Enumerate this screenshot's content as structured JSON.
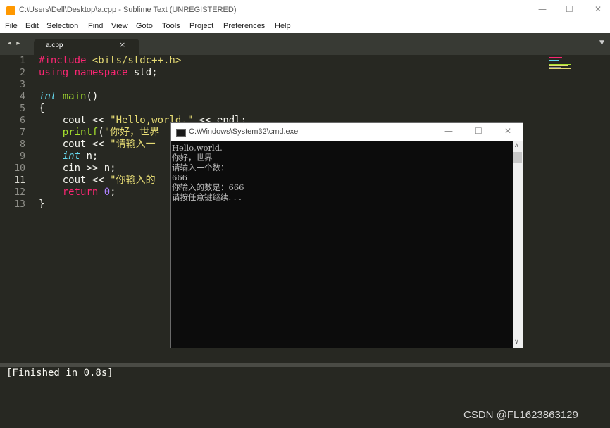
{
  "window": {
    "title": "C:\\Users\\Dell\\Desktop\\a.cpp - Sublime Text (UNREGISTERED)",
    "minimize_glyph": "—",
    "maximize_glyph": "☐",
    "close_glyph": "✕"
  },
  "menu": [
    "File",
    "Edit",
    "Selection",
    "Find",
    "View",
    "Goto",
    "Tools",
    "Project",
    "Preferences",
    "Help"
  ],
  "tabs": {
    "nav_glyph": "◂ ▸",
    "active": {
      "label": "a.cpp",
      "close_glyph": "×"
    },
    "menu_glyph": "▼"
  },
  "editor": {
    "line_numbers": [
      "1",
      "2",
      "3",
      "4",
      "5",
      "6",
      "7",
      "8",
      "9",
      "10",
      "11",
      "12",
      "13"
    ],
    "current_line": 11,
    "code": [
      [
        {
          "c": "k",
          "t": "#include "
        },
        {
          "c": "s",
          "t": "<bits/stdc++.h>"
        }
      ],
      [
        {
          "c": "k",
          "t": "using namespace "
        },
        {
          "c": "",
          "t": "std;"
        }
      ],
      [],
      [
        {
          "c": "t",
          "t": "int"
        },
        {
          "c": "",
          "t": " "
        },
        {
          "c": "f",
          "t": "main"
        },
        {
          "c": "",
          "t": "()"
        }
      ],
      [
        {
          "c": "",
          "t": "{"
        }
      ],
      [
        {
          "c": "",
          "t": "    cout << "
        },
        {
          "c": "s",
          "t": "\"Hello,world.\""
        },
        {
          "c": "",
          "t": " << endl;"
        }
      ],
      [
        {
          "c": "",
          "t": "    "
        },
        {
          "c": "f",
          "t": "printf"
        },
        {
          "c": "",
          "t": "("
        },
        {
          "c": "s",
          "t": "\"你好，世界"
        }
      ],
      [
        {
          "c": "",
          "t": "    cout << "
        },
        {
          "c": "s",
          "t": "\"请输入一"
        }
      ],
      [
        {
          "c": "",
          "t": "    "
        },
        {
          "c": "t",
          "t": "int"
        },
        {
          "c": "",
          "t": " n;"
        }
      ],
      [
        {
          "c": "",
          "t": "    cin >> n;"
        }
      ],
      [
        {
          "c": "",
          "t": "    cout << "
        },
        {
          "c": "s",
          "t": "\"你输入的"
        }
      ],
      [
        {
          "c": "",
          "t": "    "
        },
        {
          "c": "k",
          "t": "return"
        },
        {
          "c": "",
          "t": " "
        },
        {
          "c": "n",
          "t": "0"
        },
        {
          "c": "",
          "t": ";"
        }
      ],
      [
        {
          "c": "",
          "t": "}"
        }
      ]
    ]
  },
  "cmd": {
    "title": "C:\\Windows\\System32\\cmd.exe",
    "minimize_glyph": "—",
    "maximize_glyph": "☐",
    "close_glyph": "✕",
    "output": [
      "Hello,world.",
      "你好，世界",
      "请输入一个数：",
      "666",
      "你输入的数是：666",
      "请按任意键继续. . ."
    ],
    "scroll_up_glyph": "∧",
    "scroll_down_glyph": "∨"
  },
  "output_panel": {
    "text": "[Finished in 0.8s]"
  },
  "watermark": "CSDN @FL1623863129",
  "colors": {
    "editor_bg": "#272822",
    "keyword": "#f92672",
    "type": "#66d9ef",
    "function": "#a6e22e",
    "string": "#e6db74",
    "number": "#ae81ff",
    "cmd_bg": "#0c0c0c"
  },
  "icons": {
    "app": "sublime-text-icon",
    "cmd": "cmd-window-icon"
  }
}
